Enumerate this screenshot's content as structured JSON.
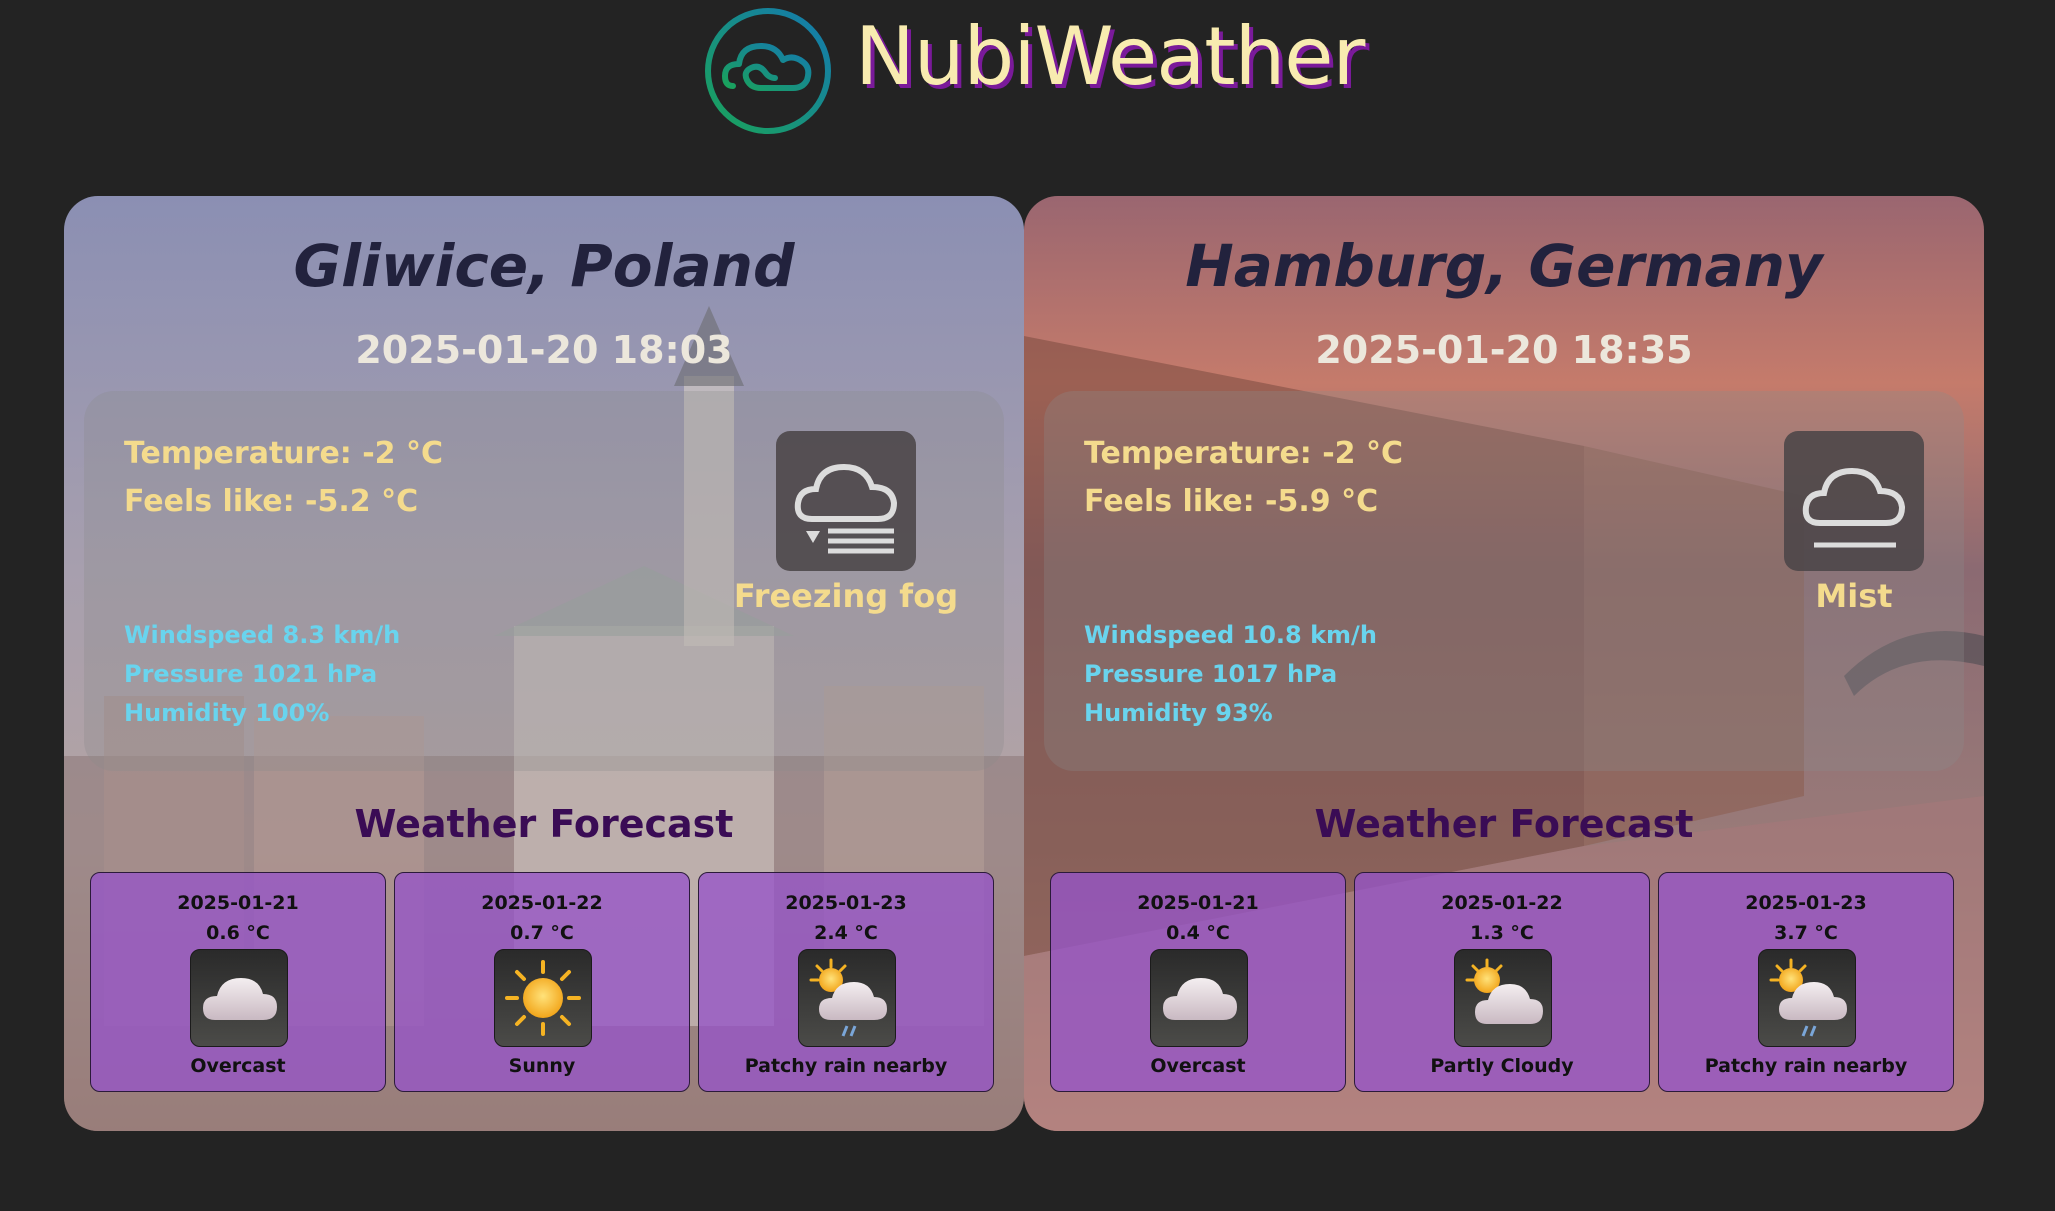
{
  "app": {
    "title": "NubiWeather",
    "logo_icon": "cloud-logo-icon"
  },
  "colors": {
    "background": "#232323",
    "brand_text": "#f8ebb0",
    "brand_shadow": "#7a1a9a",
    "temperature_text": "#f4db8d",
    "stats_text": "#69d4ee",
    "forecast_title": "#3a0c55",
    "forecast_box": "#9655c8"
  },
  "cities": [
    {
      "name": "Gliwice, Poland",
      "datetime": "2025-01-20 18:03",
      "temperature": "Temperature: -2 °C",
      "feels_like": "Feels like: -5.2 °C",
      "condition": "Freezing fog",
      "condition_icon": "freezing-fog-icon",
      "windspeed": "Windspeed 8.3 km/h",
      "pressure": "Pressure 1021 hPa",
      "humidity": "Humidity 100%",
      "forecast_title": "Weather Forecast",
      "forecast": [
        {
          "date": "2025-01-21",
          "temp": "0.6 °C",
          "condition": "Overcast",
          "icon": "overcast-icon"
        },
        {
          "date": "2025-01-22",
          "temp": "0.7 °C",
          "condition": "Sunny",
          "icon": "sunny-icon"
        },
        {
          "date": "2025-01-23",
          "temp": "2.4 °C",
          "condition": "Patchy rain nearby",
          "icon": "patchy-rain-icon"
        }
      ]
    },
    {
      "name": "Hamburg, Germany",
      "datetime": "2025-01-20 18:35",
      "temperature": "Temperature: -2 °C",
      "feels_like": "Feels like: -5.9 °C",
      "condition": "Mist",
      "condition_icon": "mist-icon",
      "windspeed": "Windspeed 10.8 km/h",
      "pressure": "Pressure 1017 hPa",
      "humidity": "Humidity 93%",
      "forecast_title": "Weather Forecast",
      "forecast": [
        {
          "date": "2025-01-21",
          "temp": "0.4 °C",
          "condition": "Overcast",
          "icon": "overcast-icon"
        },
        {
          "date": "2025-01-22",
          "temp": "1.3 °C",
          "condition": "Partly Cloudy",
          "icon": "partly-cloudy-icon"
        },
        {
          "date": "2025-01-23",
          "temp": "3.7 °C",
          "condition": "Patchy rain nearby",
          "icon": "patchy-rain-icon"
        }
      ]
    }
  ]
}
